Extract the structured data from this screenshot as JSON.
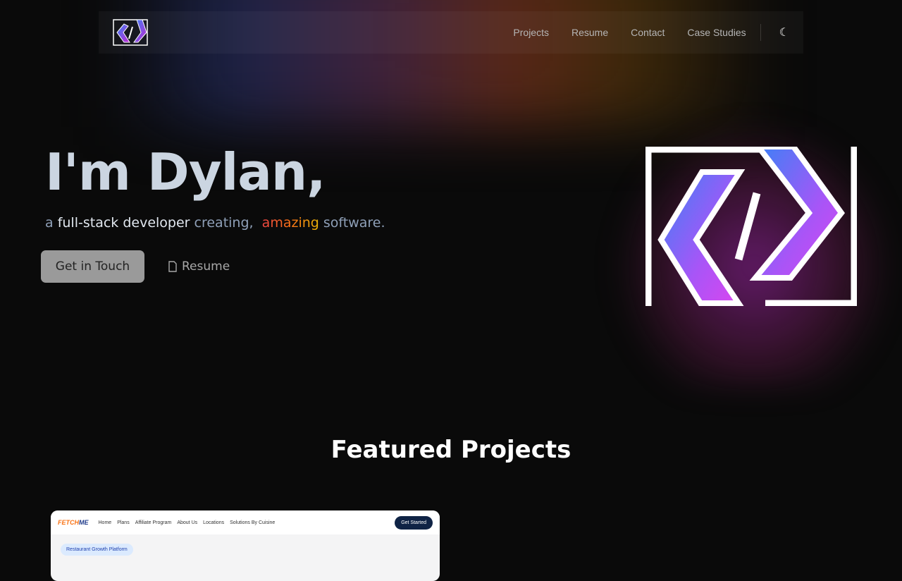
{
  "nav": {
    "links": [
      "Projects",
      "Resume",
      "Contact",
      "Case Studies"
    ],
    "theme_icon": "moon-icon"
  },
  "hero": {
    "title": "I'm Dylan,",
    "sub_a": "a",
    "sub_b": "full-stack developer",
    "sub_c": "creating,",
    "sub_d": "amazing",
    "sub_e": "software.",
    "cta": "Get in Touch",
    "resume": "Resume"
  },
  "featured": {
    "title": "Featured Projects",
    "card": {
      "brand_a": "FETCH",
      "brand_b": "ME",
      "nav": [
        "Home",
        "Plans",
        "Affiliate Program",
        "About Us",
        "Locations",
        "Solutions By Cuisine"
      ],
      "cta": "Get Started",
      "pill": "Restaurant Growth Platform"
    }
  }
}
